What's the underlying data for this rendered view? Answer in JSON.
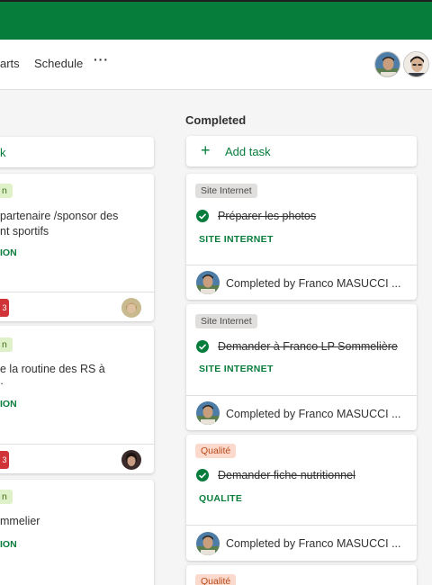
{
  "nav": {
    "charts_label": "arts",
    "schedule_label": "Schedule",
    "more_label": "···"
  },
  "left_column": {
    "add_task_fragment": "k",
    "cards": [
      {
        "label_fragment": "n",
        "title_lines": [
          "partenaire /sponsor des",
          "nt sportifs"
        ],
        "bucket_fragment": "ION",
        "badge": "3"
      },
      {
        "label_fragment": "n",
        "title_lines": [
          "e la routine des RS à",
          "·"
        ],
        "bucket_fragment": "ION",
        "badge": "3"
      },
      {
        "label_fragment": "n",
        "title_lines": [
          "mmelier"
        ],
        "bucket_fragment": "ION"
      }
    ]
  },
  "completed_column": {
    "title": "Completed",
    "add_task_label": "Add task",
    "cards": [
      {
        "label": "Site Internet",
        "label_color": "#e1dfdd",
        "task": "Préparer les photos",
        "bucket": "SITE INTERNET",
        "completed_by": "Completed by Franco MASUCCI ..."
      },
      {
        "label": "Site Internet",
        "label_color": "#e1dfdd",
        "task": "Demander à Franco LP Sommelière",
        "bucket": "SITE INTERNET",
        "completed_by": "Completed by Franco MASUCCI ..."
      },
      {
        "label": "Qualité",
        "label_color": "#fbd9cc",
        "task": "Demander fiche nutritionnel",
        "bucket": "QUALITE",
        "completed_by": "Completed by Franco MASUCCI ..."
      },
      {
        "label": "Qualité",
        "label_color": "#fbd9cc"
      }
    ]
  },
  "colors": {
    "brand_green": "#077d3c",
    "priority_red": "#d13438"
  }
}
